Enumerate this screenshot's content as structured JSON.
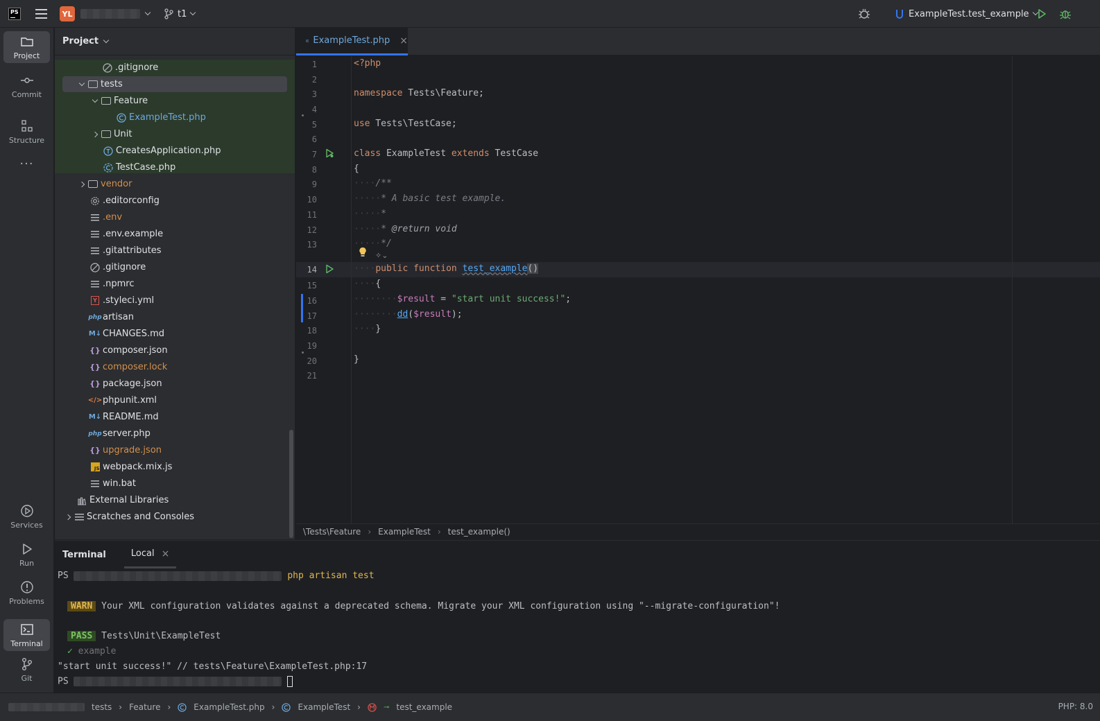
{
  "titlebar": {
    "avatar_initials": "YL",
    "branch": "t1",
    "run_config": "ExampleTest.test_example"
  },
  "toolstrip": {
    "top": [
      {
        "label": "Project",
        "icon": "folder-icon"
      },
      {
        "label": "Commit",
        "icon": "commit-icon"
      },
      {
        "label": "Structure",
        "icon": "structure-icon"
      }
    ],
    "bottom": [
      {
        "label": "Services",
        "icon": "services-icon"
      },
      {
        "label": "Run",
        "icon": "run-icon"
      },
      {
        "label": "Problems",
        "icon": "problems-icon"
      },
      {
        "label": "Terminal",
        "icon": "terminal-icon"
      },
      {
        "label": "Git",
        "icon": "git-icon"
      }
    ]
  },
  "project": {
    "title": "Project",
    "tree": [
      {
        "name": ".gitignore"
      },
      {
        "name": "tests"
      },
      {
        "name": "Feature"
      },
      {
        "name": "ExampleTest.php"
      },
      {
        "name": "Unit"
      },
      {
        "name": "CreatesApplication.php"
      },
      {
        "name": "TestCase.php"
      },
      {
        "name": "vendor"
      },
      {
        "name": ".editorconfig"
      },
      {
        "name": ".env"
      },
      {
        "name": ".env.example"
      },
      {
        "name": ".gitattributes"
      },
      {
        "name": ".gitignore"
      },
      {
        "name": ".npmrc"
      },
      {
        "name": ".styleci.yml"
      },
      {
        "name": "artisan"
      },
      {
        "name": "CHANGES.md"
      },
      {
        "name": "composer.json"
      },
      {
        "name": "composer.lock"
      },
      {
        "name": "package.json"
      },
      {
        "name": "phpunit.xml"
      },
      {
        "name": "README.md"
      },
      {
        "name": "server.php"
      },
      {
        "name": "upgrade.json"
      },
      {
        "name": "webpack.mix.js"
      },
      {
        "name": "win.bat"
      },
      {
        "name": "External Libraries"
      },
      {
        "name": "Scratches and Consoles"
      }
    ],
    "colors": {
      "modified": "#6fa8dc",
      "ignored": "#d48f4d",
      "text": "#dfe1e5"
    }
  },
  "editor": {
    "tab": "ExampleTest.php",
    "breadcrumbs": [
      "\\Tests\\Feature",
      "ExampleTest",
      "test_example()"
    ],
    "line_numbers": [
      "1",
      "2",
      "3",
      "4",
      "5",
      "6",
      "7",
      "8",
      "9",
      "10",
      "11",
      "12",
      "13",
      "14",
      "15",
      "16",
      "17",
      "18",
      "19",
      "20",
      "21"
    ],
    "lines": {
      "l1": "<?php",
      "l3a": "namespace",
      "l3b": " Tests\\Feature;",
      "l5a": "use",
      "l5b": " Tests\\TestCase;",
      "l7a": "class",
      "l7b": " ExampleTest ",
      "l7c": "extends",
      "l7d": " TestCase",
      "l8": "{",
      "l9": "/**",
      "l10": "* A basic test example.",
      "l11": "*",
      "l12a": "* ",
      "l12b": "@return",
      "l12c": " void",
      "l13": "*/",
      "l14a": "public",
      "l14b": " function ",
      "l14c": "test_example",
      "l14d": "()",
      "l15": "{",
      "l16a": "$result",
      "l16b": " = ",
      "l16c": "\"start unit success!\"",
      "l16d": ";",
      "l17a": "dd",
      "l17b": "(",
      "l17c": "$result",
      "l17d": ");",
      "l18": "}",
      "l20": "}"
    }
  },
  "terminal": {
    "title": "Terminal",
    "tab": "Local",
    "prompt": "PS",
    "command": "php artisan test",
    "warn_badge": "WARN",
    "warn_text": "Your XML configuration validates against a deprecated schema. Migrate your XML configuration using \"--migrate-configuration\"!",
    "pass_badge": "PASS",
    "pass_text": "Tests\\Unit\\ExampleTest",
    "check": "✓",
    "test_name": "example",
    "dump": "\"start unit success!\" // tests\\Feature\\ExampleTest.php:17",
    "prompt2": "PS"
  },
  "statusbar": {
    "crumbs": [
      "tests",
      "Feature",
      "ExampleTest.php",
      "ExampleTest",
      "test_example"
    ],
    "php_version": "PHP: 8.0"
  }
}
